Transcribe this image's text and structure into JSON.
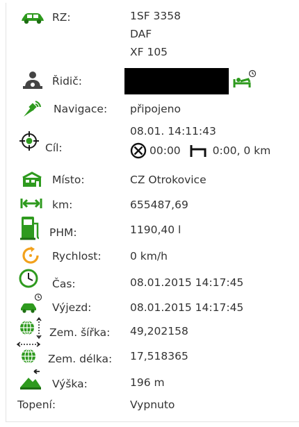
{
  "vehicle": {
    "rz": {
      "label": "RZ:",
      "lines": [
        "1SF 3358",
        "DAF",
        "XF 105"
      ]
    },
    "driver": {
      "label": "Řidič:"
    },
    "navigation": {
      "label": "Navigace:",
      "value": "připojeno"
    },
    "target": {
      "label": "Cíl:",
      "time": "08.01. 14:11:43",
      "remaining": "00:00",
      "rest": "0:00, 0 km"
    },
    "place": {
      "label": "Místo:",
      "value": "CZ Otrokovice"
    },
    "km": {
      "label": "km:",
      "value": "655487,69"
    },
    "fuel": {
      "label": "PHM:",
      "value": "1190,40 l"
    },
    "speed": {
      "label": "Rychlost:",
      "value": "0 km/h"
    },
    "time": {
      "label": "Čas:",
      "value": "08.01.2015 14:17:45"
    },
    "departure": {
      "label": "Výjezd:",
      "value": "08.01.2015 14:17:45"
    },
    "latitude": {
      "label": "Zem. šířka:",
      "value": "49,202158"
    },
    "longitude": {
      "label": "Zem. délka:",
      "value": "17,518365"
    },
    "altitude": {
      "label": "Výška:",
      "value": "196 m"
    },
    "heating": {
      "label": "Topení:",
      "value": "Vypnuto"
    }
  },
  "icons": {
    "car": "car-icon",
    "driver": "driver-icon",
    "resting": "resting-driver-icon",
    "navigation": "satellite-icon",
    "target": "crosshair-icon",
    "place": "building-icon",
    "km": "distance-icon",
    "fuel": "fuel-icon",
    "speed": "speed-icon",
    "time": "clock-icon",
    "departure": "departure-icon",
    "latitude": "globe-latitude-icon",
    "longitude": "globe-longitude-icon",
    "altitude": "altitude-icon"
  },
  "colors": {
    "accent": "#2e9a1e",
    "dark": "#333333",
    "orange": "#f2a11c"
  }
}
